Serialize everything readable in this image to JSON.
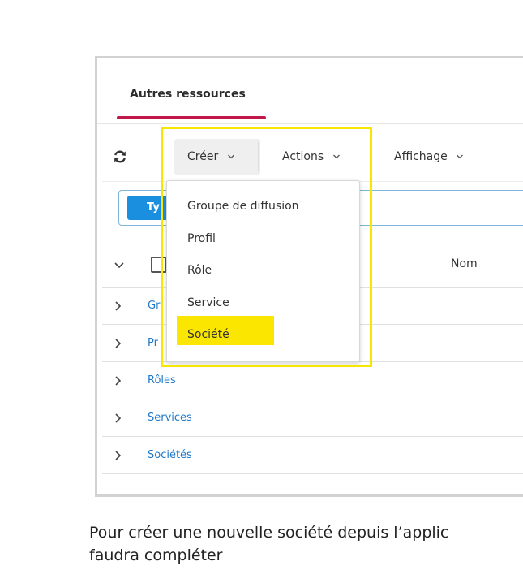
{
  "tabs": {
    "active_label": "Autres ressources"
  },
  "toolbar": {
    "creer_label": "Créer",
    "actions_label": "Actions",
    "affichage_label": "Affichage"
  },
  "filter": {
    "type_pill_label": "Ty"
  },
  "table": {
    "column_nom": "Nom",
    "rows": [
      {
        "label": "Gr"
      },
      {
        "label": "Pr"
      },
      {
        "label": "Rôles"
      },
      {
        "label": "Services"
      },
      {
        "label": "Sociétés"
      }
    ]
  },
  "dropdown": {
    "items": [
      {
        "label": "Groupe de diffusion"
      },
      {
        "label": "Profil"
      },
      {
        "label": "Rôle"
      },
      {
        "label": "Service"
      },
      {
        "label": "Société",
        "highlighted": true
      }
    ]
  },
  "colors": {
    "tab_underline": "#c2174a",
    "highlight_yellow": "#fbe600",
    "link_blue": "#1f78c8",
    "pill_blue": "#1a8fe0"
  },
  "caption": {
    "line1": "Pour créer une nouvelle société depuis l’applic",
    "line2": "faudra compléter"
  }
}
